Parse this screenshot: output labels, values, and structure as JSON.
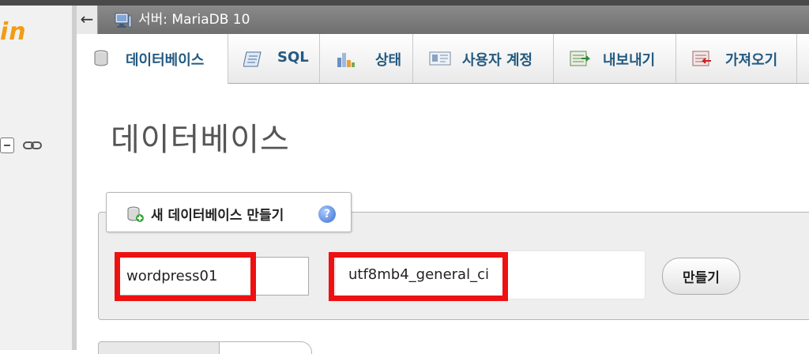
{
  "app": {
    "logo_fragment": "in"
  },
  "breadcrumb": {
    "back_label": "←",
    "server_label": "서버: MariaDB 10"
  },
  "tabs": [
    {
      "label": "데이터베이스",
      "icon": "database-icon",
      "active": true
    },
    {
      "label": "SQL",
      "icon": "sql-icon",
      "active": false
    },
    {
      "label": "상태",
      "icon": "status-chart-icon",
      "active": false
    },
    {
      "label": "사용자 계정",
      "icon": "user-accounts-icon",
      "active": false
    },
    {
      "label": "내보내기",
      "icon": "export-icon",
      "active": false
    },
    {
      "label": "가져오기",
      "icon": "import-icon",
      "active": false
    }
  ],
  "page": {
    "title": "데이터베이스"
  },
  "create_db": {
    "legend": "새 데이터베이스 만들기",
    "db_name_value": "wordpress01",
    "collation_value": "utf8mb4_general_ci",
    "create_label": "만들기"
  },
  "colors": {
    "tab_text": "#235a81",
    "highlight": "#ee1111",
    "logo": "#f39c12"
  }
}
